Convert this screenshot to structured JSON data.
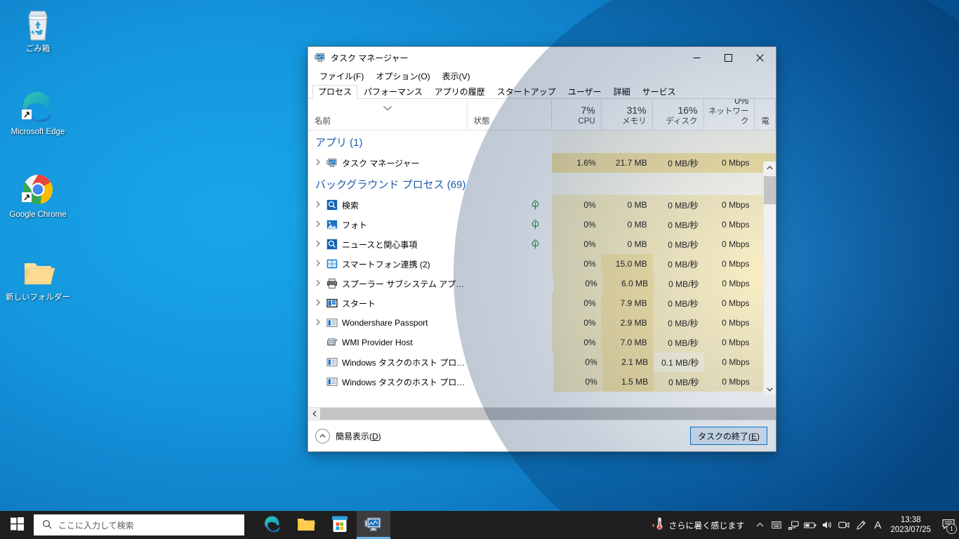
{
  "desktop": {
    "icons": [
      {
        "label": "ごみ箱",
        "icon": "recycle-bin-icon"
      },
      {
        "label": "Microsoft Edge",
        "icon": "microsoft-edge-icon"
      },
      {
        "label": "Google Chrome",
        "icon": "google-chrome-icon"
      },
      {
        "label": "新しいフォルダー",
        "icon": "folder-icon"
      }
    ]
  },
  "window": {
    "title": "タスク マネージャー",
    "icon": "task-manager-icon",
    "controls": {
      "minimize": "─",
      "maximize": "☐",
      "close": "✕"
    },
    "menu": [
      "ファイル(F)",
      "オプション(O)",
      "表示(V)"
    ],
    "tabs": [
      {
        "label": "プロセス",
        "active": true
      },
      {
        "label": "パフォーマンス",
        "active": false
      },
      {
        "label": "アプリの履歴",
        "active": false
      },
      {
        "label": "スタートアップ",
        "active": false
      },
      {
        "label": "ユーザー",
        "active": false
      },
      {
        "label": "詳細",
        "active": false
      },
      {
        "label": "サービス",
        "active": false
      }
    ],
    "columns": [
      {
        "key": "name",
        "label": "名前",
        "pct": "",
        "sorted": true
      },
      {
        "key": "state",
        "label": "状態",
        "pct": ""
      },
      {
        "key": "cpu",
        "label": "CPU",
        "pct": "7%"
      },
      {
        "key": "mem",
        "label": "メモリ",
        "pct": "31%"
      },
      {
        "key": "disk",
        "label": "ディスク",
        "pct": "16%"
      },
      {
        "key": "net",
        "label": "ネットワーク",
        "pct": "0%"
      },
      {
        "key": "power",
        "label": "電",
        "pct": ""
      }
    ],
    "groups": [
      {
        "label": "アプリ",
        "count": "(1)"
      },
      {
        "label": "バックグラウンド プロセス",
        "count": "(69)"
      }
    ],
    "rows": [
      {
        "type": "group",
        "group": 0
      },
      {
        "type": "proc",
        "expandable": true,
        "icon": "task-manager-icon",
        "name": "タスク マネージャー",
        "state": "",
        "cpu": "1.6%",
        "mem": "21.7 MB",
        "disk": "0 MB/秒",
        "net": "0 Mbps",
        "shade": {
          "cpu": "h3",
          "mem": "h3",
          "disk": "h3",
          "net": "h3"
        }
      },
      {
        "type": "group",
        "group": 1
      },
      {
        "type": "proc",
        "expandable": true,
        "icon": "search-icon",
        "name": "検索",
        "state": "leaf",
        "cpu": "0%",
        "mem": "0 MB",
        "disk": "0 MB/秒",
        "net": "0 Mbps",
        "shade": {
          "cpu": "h2",
          "mem": "h2",
          "disk": "h2",
          "net": "h2"
        }
      },
      {
        "type": "proc",
        "expandable": true,
        "icon": "photos-icon",
        "name": "フォト",
        "state": "leaf",
        "cpu": "0%",
        "mem": "0 MB",
        "disk": "0 MB/秒",
        "net": "0 Mbps",
        "shade": {
          "cpu": "h2",
          "mem": "h2",
          "disk": "h2",
          "net": "h2"
        }
      },
      {
        "type": "proc",
        "expandable": true,
        "icon": "search-icon",
        "name": "ニュースと関心事項",
        "state": "leaf",
        "cpu": "0%",
        "mem": "0 MB",
        "disk": "0 MB/秒",
        "net": "0 Mbps",
        "shade": {
          "cpu": "h2",
          "mem": "h2",
          "disk": "h2",
          "net": "h2"
        }
      },
      {
        "type": "proc",
        "expandable": true,
        "icon": "phone-link-icon",
        "name": "スマートフォン連携 (2)",
        "state": "",
        "cpu": "0%",
        "mem": "15.0 MB",
        "disk": "0 MB/秒",
        "net": "0 Mbps",
        "shade": {
          "cpu": "h2",
          "mem": "h3",
          "disk": "h2",
          "net": "h2"
        }
      },
      {
        "type": "proc",
        "expandable": true,
        "icon": "printer-icon",
        "name": "スプーラー サブシステム アプリケーション",
        "state": "",
        "cpu": "0%",
        "mem": "6.0 MB",
        "disk": "0 MB/秒",
        "net": "0 Mbps",
        "shade": {
          "cpu": "h2",
          "mem": "h3",
          "disk": "h2",
          "net": "h2"
        }
      },
      {
        "type": "proc",
        "expandable": true,
        "icon": "start-menu-icon",
        "name": "スタート",
        "state": "",
        "cpu": "0%",
        "mem": "7.9 MB",
        "disk": "0 MB/秒",
        "net": "0 Mbps",
        "shade": {
          "cpu": "h2",
          "mem": "h3",
          "disk": "h2",
          "net": "h2"
        }
      },
      {
        "type": "proc",
        "expandable": true,
        "icon": "generic-app-icon",
        "name": "Wondershare Passport",
        "state": "",
        "cpu": "0%",
        "mem": "2.9 MB",
        "disk": "0 MB/秒",
        "net": "0 Mbps",
        "shade": {
          "cpu": "h2",
          "mem": "h3",
          "disk": "h2",
          "net": "h2"
        }
      },
      {
        "type": "proc",
        "expandable": false,
        "icon": "wmi-host-icon",
        "name": "WMI Provider Host",
        "state": "",
        "cpu": "0%",
        "mem": "7.0 MB",
        "disk": "0 MB/秒",
        "net": "0 Mbps",
        "shade": {
          "cpu": "h2",
          "mem": "h3",
          "disk": "h2",
          "net": "h2"
        }
      },
      {
        "type": "proc",
        "expandable": false,
        "icon": "generic-app-icon",
        "name": "Windows タスクのホスト プロセス",
        "state": "",
        "cpu": "0%",
        "mem": "2.1 MB",
        "disk": "0.1 MB/秒",
        "net": "0 Mbps",
        "shade": {
          "cpu": "h2",
          "mem": "h3",
          "disk": "h1",
          "net": "h2"
        }
      },
      {
        "type": "proc",
        "expandable": false,
        "icon": "generic-app-icon",
        "name": "Windows タスクのホスト プロセス",
        "state": "",
        "cpu": "0%",
        "mem": "1.5 MB",
        "disk": "0 MB/秒",
        "net": "0 Mbps",
        "shade": {
          "cpu": "h2",
          "mem": "h3",
          "disk": "h2",
          "net": "h2"
        }
      }
    ],
    "footer": {
      "less_details": "簡易表示(D)",
      "less_details_accel": "D",
      "end_task": "タスクの終了(E)",
      "end_task_accel": "E"
    }
  },
  "taskbar": {
    "start_icon": "windows-start-icon",
    "search_placeholder": "ここに入力して検索",
    "apps": [
      {
        "name": "microsoft-edge-icon",
        "active": false
      },
      {
        "name": "file-explorer-icon",
        "active": false
      },
      {
        "name": "microsoft-store-icon",
        "active": false
      },
      {
        "name": "task-manager-icon",
        "active": true
      }
    ],
    "weather": {
      "icon": "thermometer-icon",
      "text": "さらに暑く感じます"
    },
    "tray_icons": [
      "show-hidden-icons-chevron",
      "keyboard-icon",
      "network-icon",
      "battery-icon",
      "volume-icon",
      "meet-now-icon",
      "pen-icon",
      "ime-mode-A-icon"
    ],
    "clock": {
      "time": "13:38",
      "date": "2023/07/25"
    },
    "notifications": {
      "icon": "action-center-icon",
      "badge": "1"
    }
  }
}
